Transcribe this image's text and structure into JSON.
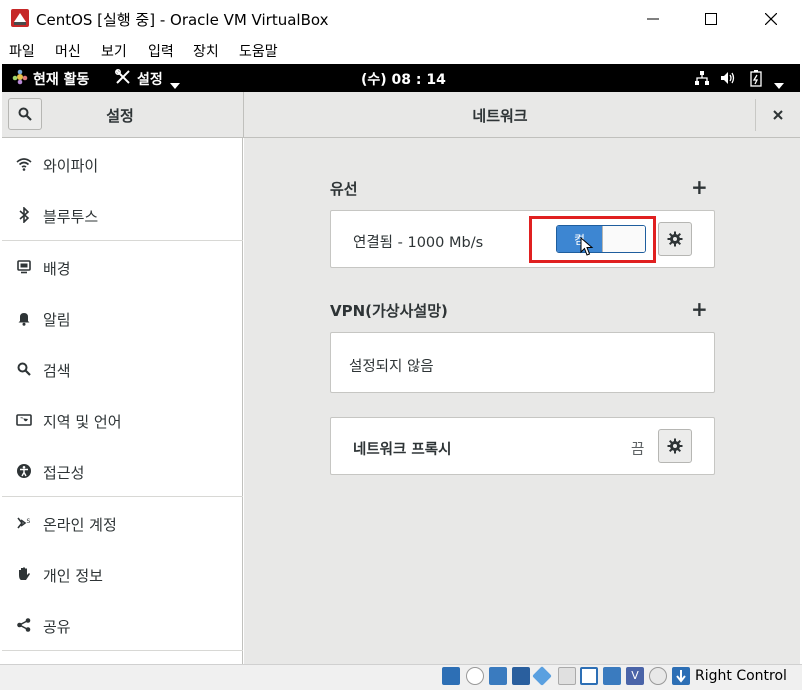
{
  "window": {
    "title": "CentOS [실행 중] - Oracle VM VirtualBox",
    "minimize": "—",
    "maximize": "☐",
    "close": "✕"
  },
  "menu": [
    "파일",
    "머신",
    "보기",
    "입력",
    "장치",
    "도움말"
  ],
  "topbar": {
    "activities": "현재 활동",
    "app_menu": "설정",
    "clock": "(수) 08 : 14"
  },
  "header": {
    "settings_title": "설정",
    "panel_title": "네트워크",
    "close_glyph": "×"
  },
  "sidebar": {
    "items": [
      {
        "label": "와이파이",
        "icon": "wifi-icon"
      },
      {
        "label": "블루투스",
        "icon": "bluetooth-icon"
      },
      {
        "label": "배경",
        "icon": "background-icon"
      },
      {
        "label": "알림",
        "icon": "bell-icon"
      },
      {
        "label": "검색",
        "icon": "search-icon"
      },
      {
        "label": "지역 및 언어",
        "icon": "region-icon"
      },
      {
        "label": "접근성",
        "icon": "accessibility-icon"
      },
      {
        "label": "온라인 계정",
        "icon": "online-accounts-icon"
      },
      {
        "label": "개인 정보",
        "icon": "privacy-hand-icon"
      },
      {
        "label": "공유",
        "icon": "share-icon"
      }
    ]
  },
  "wired": {
    "title": "유선",
    "add": "+",
    "status": "연결됨 - 1000 Mb/s",
    "switch_label": "켬",
    "switch_on": true
  },
  "vpn": {
    "title": "VPN(가상사설망)",
    "add": "+",
    "status": "설정되지 않음"
  },
  "proxy": {
    "title": "네트워크 프록시",
    "state": "끔"
  },
  "statusbar": {
    "host_key": "Right Control"
  },
  "colors": {
    "accent": "#3d86d2",
    "highlight": "#e02020",
    "panel_bg": "#e8e8e7"
  }
}
